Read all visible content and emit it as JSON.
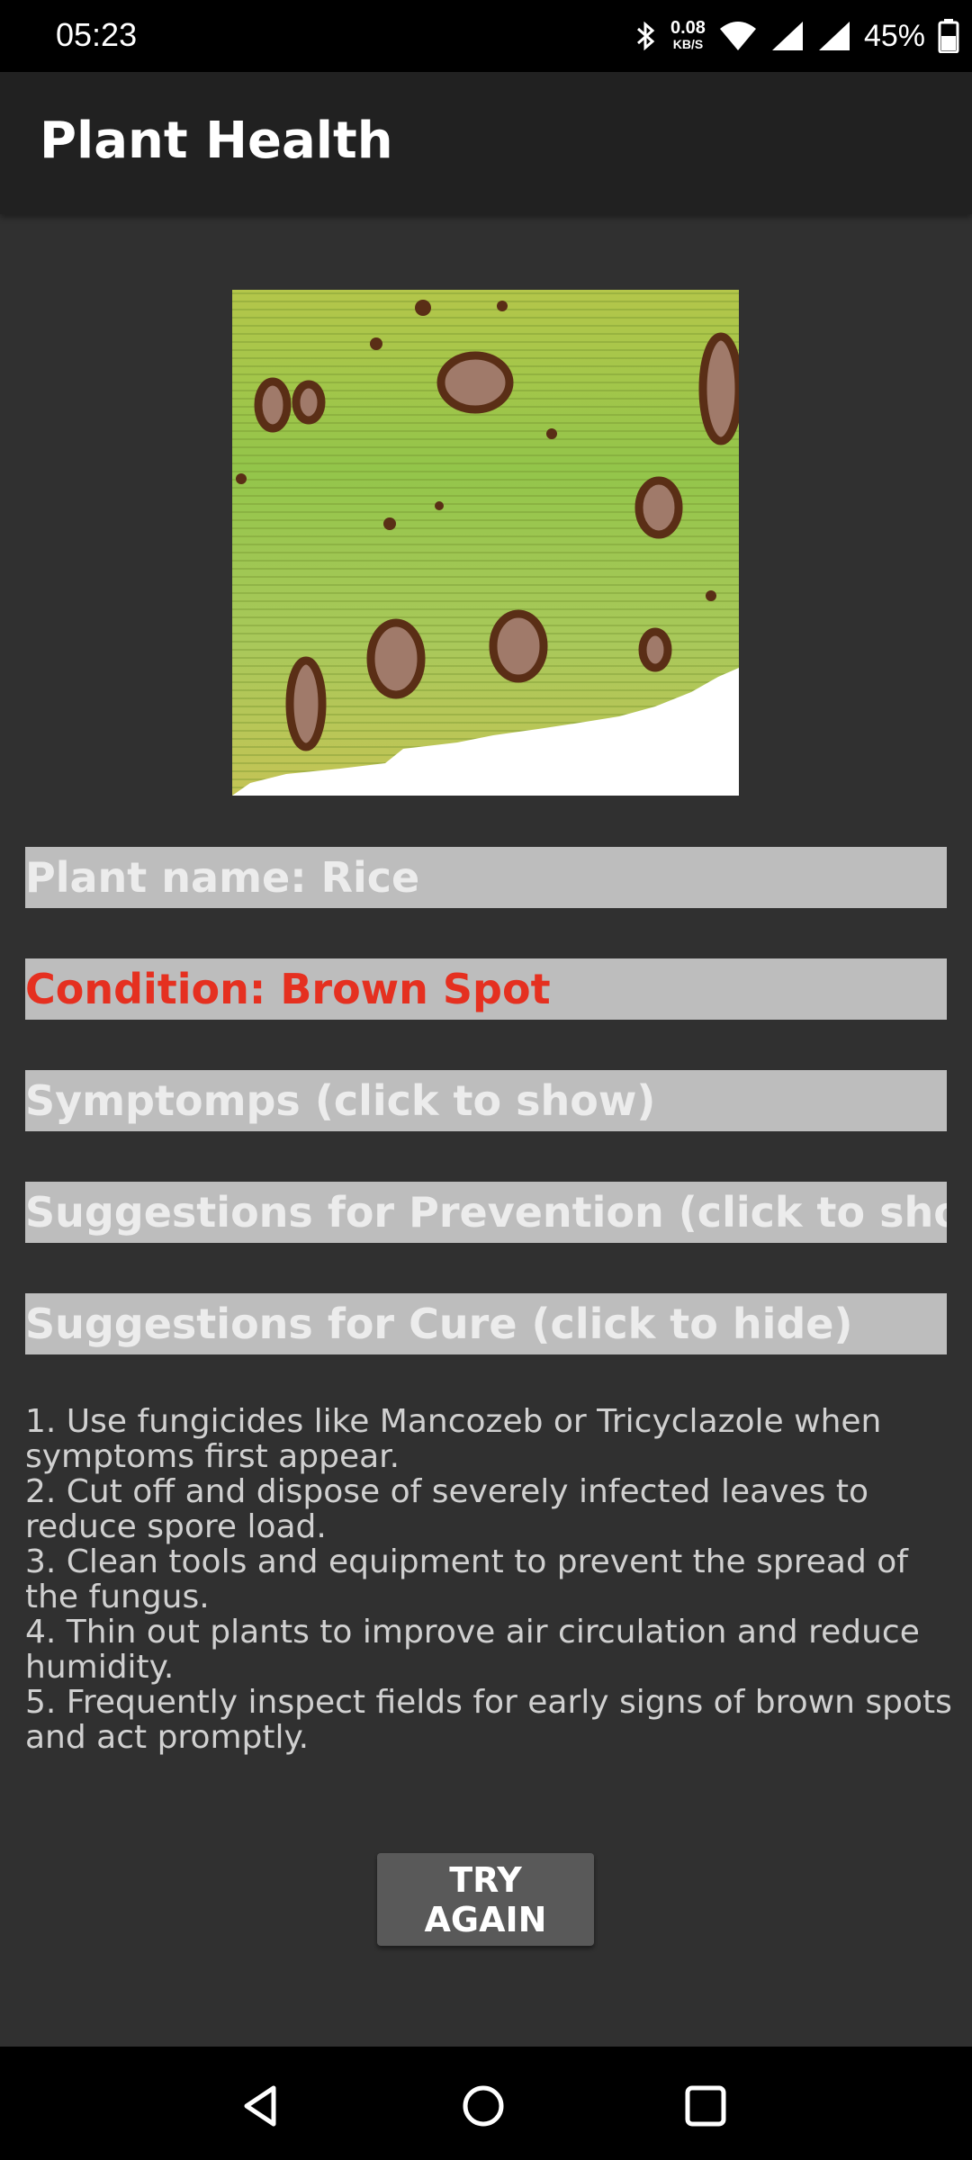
{
  "status_bar": {
    "time": "05:23",
    "net_speed_value": "0.08",
    "net_speed_unit": "KB/S",
    "battery": "45%",
    "icons": [
      "bluetooth-icon",
      "wifi-icon",
      "signal-icon",
      "signal-icon",
      "battery-icon"
    ]
  },
  "app_bar": {
    "title": "Plant Health"
  },
  "result": {
    "image_subject": "rice-leaf-with-brown-spots",
    "plant_name": "Plant name: Rice",
    "condition": "Condition: Brown Spot",
    "symptoms_toggle": "Symptomps (click to show)",
    "prevention_toggle": "Suggestions for Prevention (click to show)",
    "cure_toggle": "Suggestions for Cure (click to hide)",
    "cure_lines": [
      "1. Use fungicides like Mancozeb or Tricyclazole when symptoms first appear.",
      "2. Cut off and dispose of severely infected leaves to reduce spore load.",
      "3. Clean tools and equipment to prevent the spread of the fungus.",
      "4. Thin out plants to improve air circulation and reduce humidity.",
      "5. Frequently inspect fields for early signs of brown spots and act promptly."
    ]
  },
  "actions": {
    "try_again": "TRY AGAIN"
  },
  "colors": {
    "background": "#303030",
    "app_bar": "#212121",
    "bar_gray": "#bdbdbd",
    "condition_red": "#e53020",
    "button": "#595959"
  }
}
